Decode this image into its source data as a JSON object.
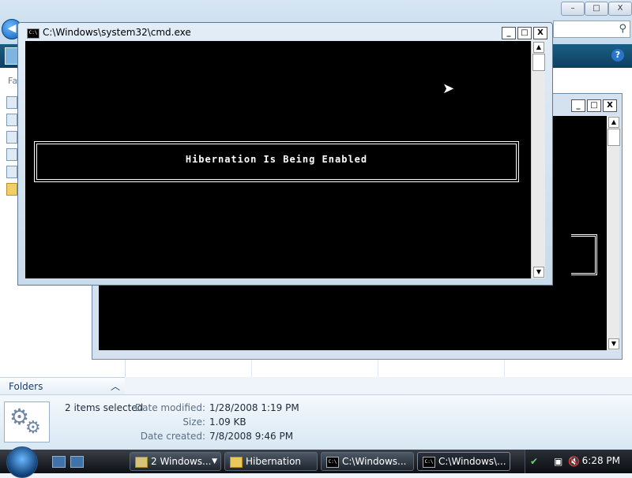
{
  "front_window": {
    "title": "C:\\Windows\\system32\\cmd.exe",
    "icon_text": "C:\\",
    "console_message": "Hibernation Is Being Enabled",
    "controls": [
      "_",
      "□",
      "X"
    ]
  },
  "back_window": {
    "controls": [
      "_",
      "□",
      "X"
    ]
  },
  "explorer": {
    "nav_truncated_label": "Fa",
    "folders_label": "Folders",
    "search_icon": "search-icon",
    "help_icon_text": "?",
    "window_controls": [
      "–",
      "□",
      "X"
    ]
  },
  "details_pane": {
    "selected_text": "2 items selected",
    "date_modified_label": "Date modified:",
    "date_modified_value": "1/28/2008 1:19 PM",
    "size_label": "Size:",
    "size_value": "1.09 KB",
    "date_created_label": "Date created:",
    "date_created_value": "7/8/2008 9:46 PM"
  },
  "taskbar": {
    "buttons": [
      {
        "label": "2 Windows...",
        "icon": "explorer-icon"
      },
      {
        "label": "Hibernation",
        "icon": "folder-icon"
      },
      {
        "label": "C:\\Windows...",
        "icon": "cmd-icon"
      },
      {
        "label": "C:\\Windows\\...",
        "icon": "cmd-icon"
      }
    ],
    "clock": "6:28 PM"
  }
}
